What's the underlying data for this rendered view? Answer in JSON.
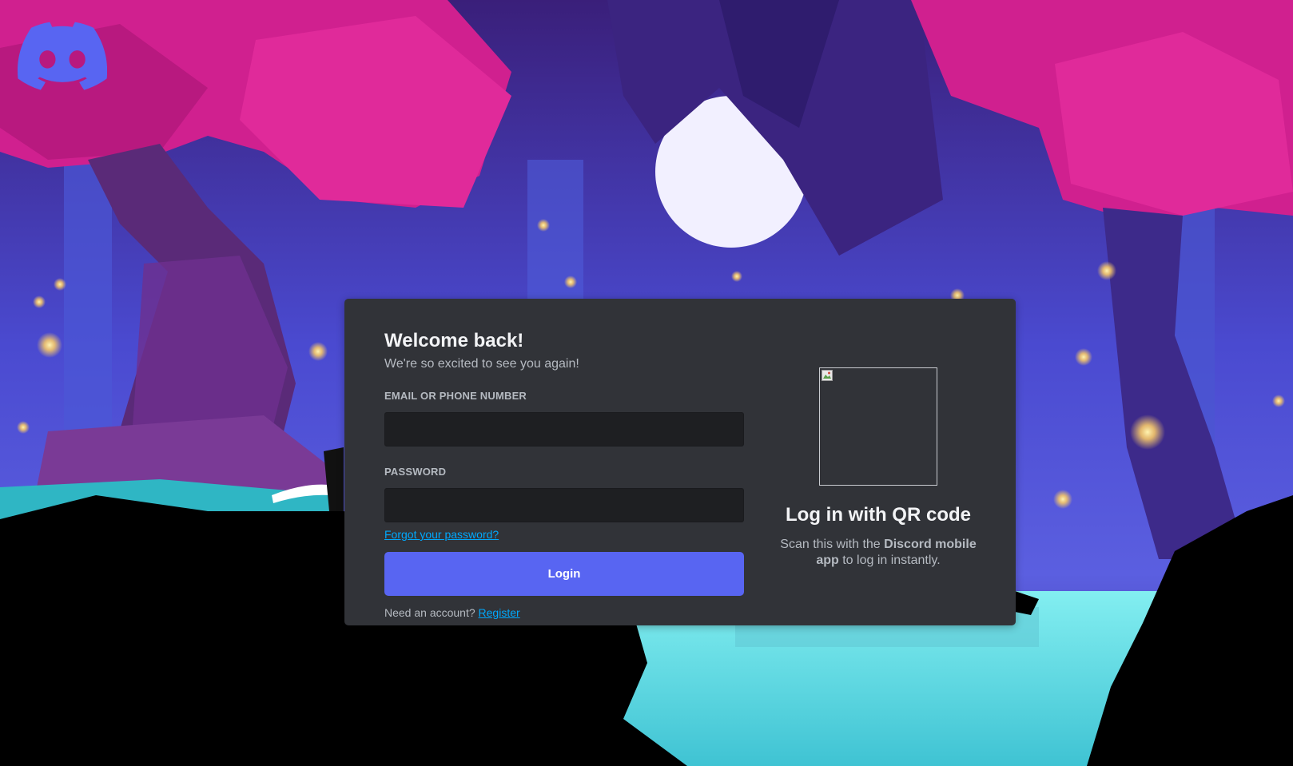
{
  "brand": {
    "name": "Discord",
    "logo_icon": "discord-logo-icon",
    "brand_color": "#5865f2"
  },
  "login": {
    "title": "Welcome back!",
    "subtitle": "We're so excited to see you again!",
    "email_label": "EMAIL OR PHONE NUMBER",
    "email_value": "",
    "password_label": "PASSWORD",
    "password_value": "",
    "forgot_link": "Forgot your password?",
    "login_button": "Login",
    "register_prompt": "Need an account?",
    "register_link": "Register"
  },
  "qr": {
    "title": "Log in with QR code",
    "text_before": "Scan this with the",
    "text_bold": "Discord mobile app",
    "text_after": "to log in instantly.",
    "image_icon": "broken-image-icon"
  },
  "colors": {
    "card_bg": "#313338",
    "input_bg": "#1e1f22",
    "link": "#00a8fc",
    "button": "#5865f2",
    "text_muted": "#b5bac1",
    "text_heading": "#f2f3f5"
  }
}
